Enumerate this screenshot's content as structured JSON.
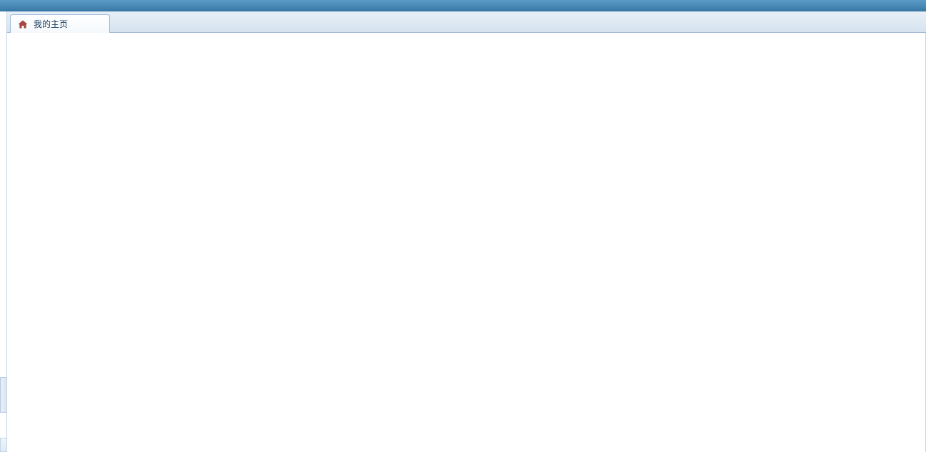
{
  "tabs": [
    {
      "label": "我的主页",
      "icon": "home-icon"
    }
  ]
}
